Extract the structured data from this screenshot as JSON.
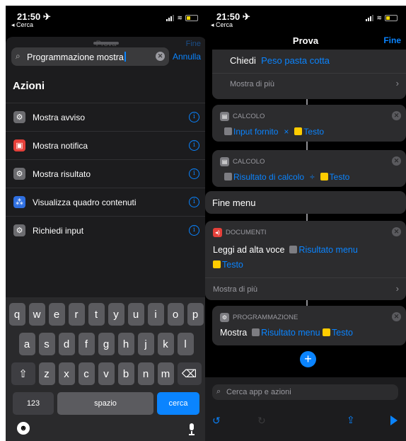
{
  "status": {
    "time": "21:50 ✈",
    "back": "◂ Cerca"
  },
  "left": {
    "ghost_title": "Prova",
    "ghost_fine": "Fine",
    "search": {
      "value": "Programmazione mostra",
      "cancel": "Annulla"
    },
    "section_title": "Azioni",
    "actions": [
      {
        "label": "Mostra avviso",
        "icon": "gear-icon",
        "color": "#6c6c70"
      },
      {
        "label": "Mostra notifica",
        "icon": "notification-icon",
        "color": "#e5403a"
      },
      {
        "label": "Mostra risultato",
        "icon": "gear-icon",
        "color": "#6c6c70"
      },
      {
        "label": "Visualizza quadro contenuti",
        "icon": "content-graph-icon",
        "color": "#2f6fe0"
      },
      {
        "label": "Richiedi input",
        "icon": "gear-icon",
        "color": "#6c6c70"
      }
    ],
    "keyboard": {
      "row1": [
        "q",
        "w",
        "e",
        "r",
        "t",
        "y",
        "u",
        "i",
        "o",
        "p"
      ],
      "row2": [
        "a",
        "s",
        "d",
        "f",
        "g",
        "h",
        "j",
        "k",
        "l"
      ],
      "row3": [
        "z",
        "x",
        "c",
        "v",
        "b",
        "n",
        "m"
      ],
      "numbers": "123",
      "space": "spazio",
      "action": "cerca"
    }
  },
  "right": {
    "title": "Prova",
    "done": "Fine",
    "ask": {
      "label": "Chiedi",
      "value": "Peso pasta cotta",
      "more": "Mostra di più"
    },
    "calc1": {
      "header": "CALCOLO",
      "input": "Input fornito",
      "op": "×",
      "var": "Testo"
    },
    "calc2": {
      "header": "CALCOLO",
      "input": "Risultato di calcolo",
      "op": "÷",
      "var": "Testo"
    },
    "end_menu": "Fine menu",
    "docs": {
      "header": "DOCUMENTI",
      "label": "Leggi ad alta voce",
      "var1": "Risultato menu",
      "var2": "Testo",
      "more": "Mostra di più"
    },
    "prog": {
      "header": "PROGRAMMAZIONE",
      "label": "Mostra",
      "var1": "Risultato menu",
      "var2": "Testo"
    },
    "search_placeholder": "Cerca app e azioni"
  },
  "colors": {
    "accent": "#0a84ff",
    "variable_yellow": "#ffcc00"
  }
}
